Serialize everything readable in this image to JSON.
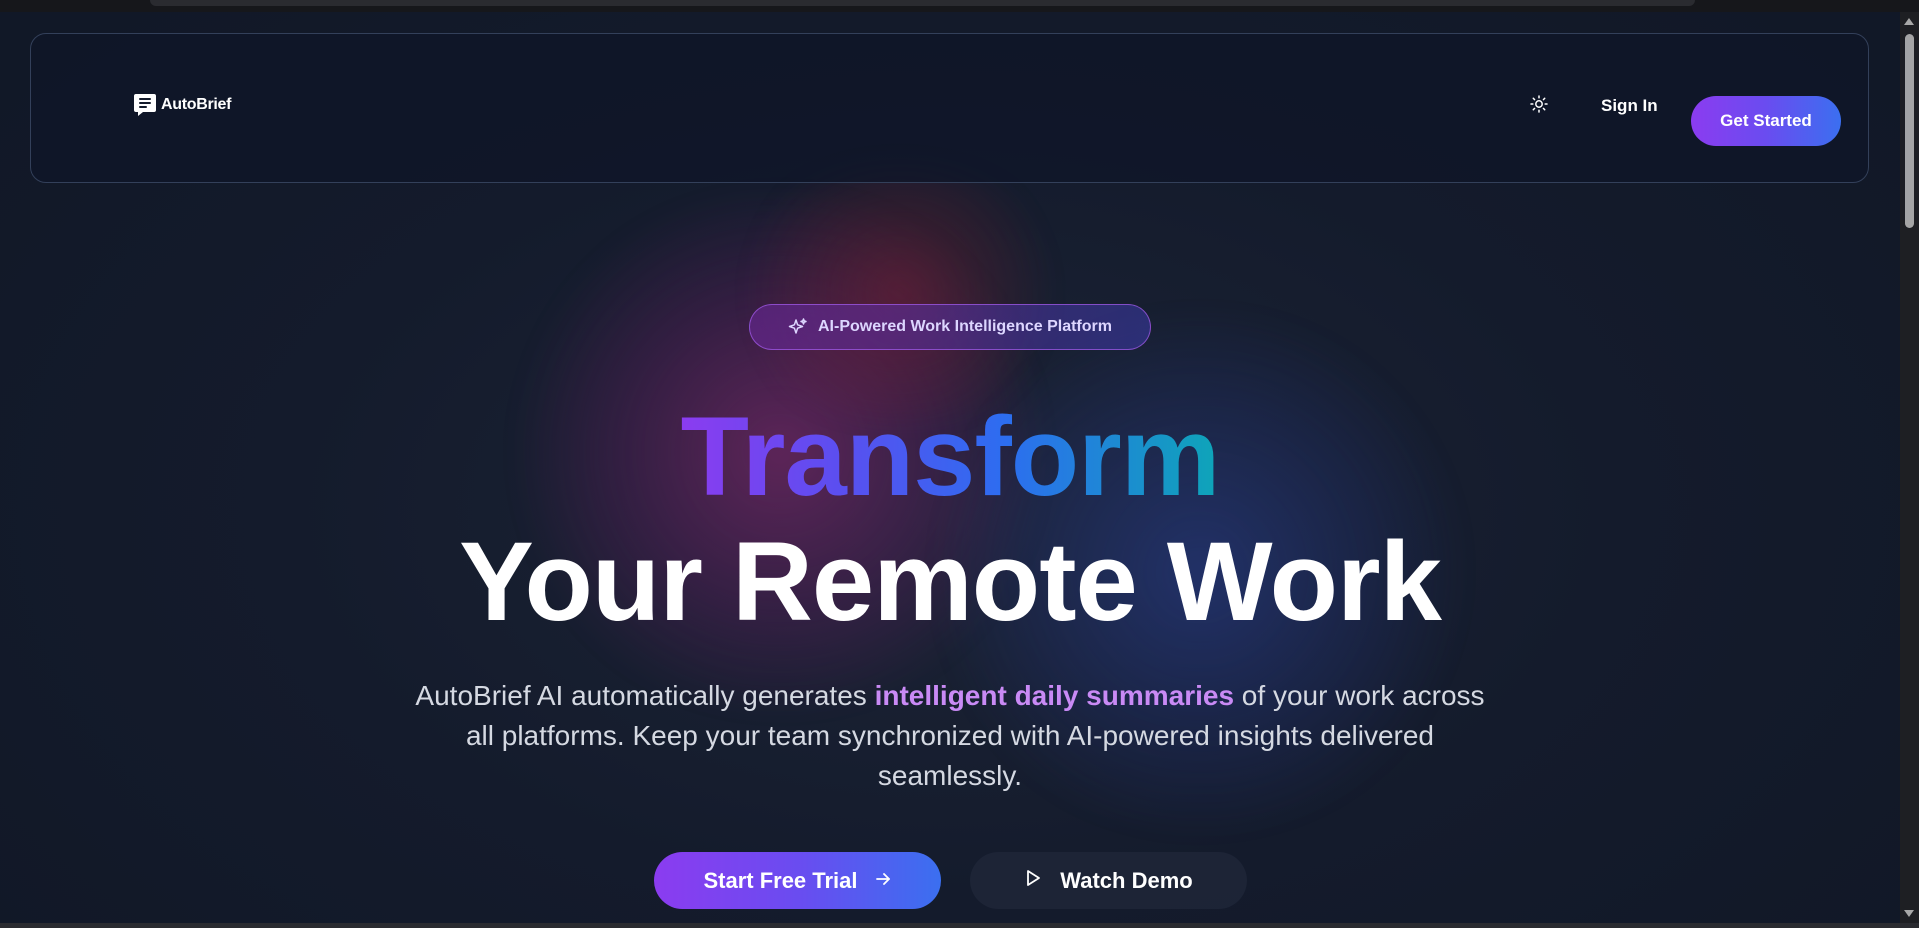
{
  "brand": {
    "name": "AutoBrief",
    "logo_icon": "chat-document-icon"
  },
  "nav": {
    "theme_icon": "sun-icon",
    "sign_in_label": "Sign In",
    "get_started_label": "Get Started"
  },
  "hero": {
    "badge_icon": "sparkle-icon",
    "badge_label": "AI-Powered Work Intelligence Platform",
    "headline_gradient": "Transform",
    "headline_plain": "Your Remote Work",
    "subtitle_before": "AutoBrief AI automatically generates ",
    "subtitle_highlight": "intelligent daily summaries",
    "subtitle_after": " of your work across all platforms. Keep your team synchronized with AI-powered insights delivered seamlessly.",
    "primary_cta_label": "Start Free Trial",
    "primary_cta_icon": "arrow-right-icon",
    "secondary_cta_label": "Watch Demo",
    "secondary_cta_icon": "play-icon"
  },
  "colors": {
    "background": "#131a2b",
    "accent_purple": "#8b3cf0",
    "accent_blue": "#3b6ff0",
    "accent_teal": "#0ea5b8",
    "highlight_text": "#c98af5"
  }
}
